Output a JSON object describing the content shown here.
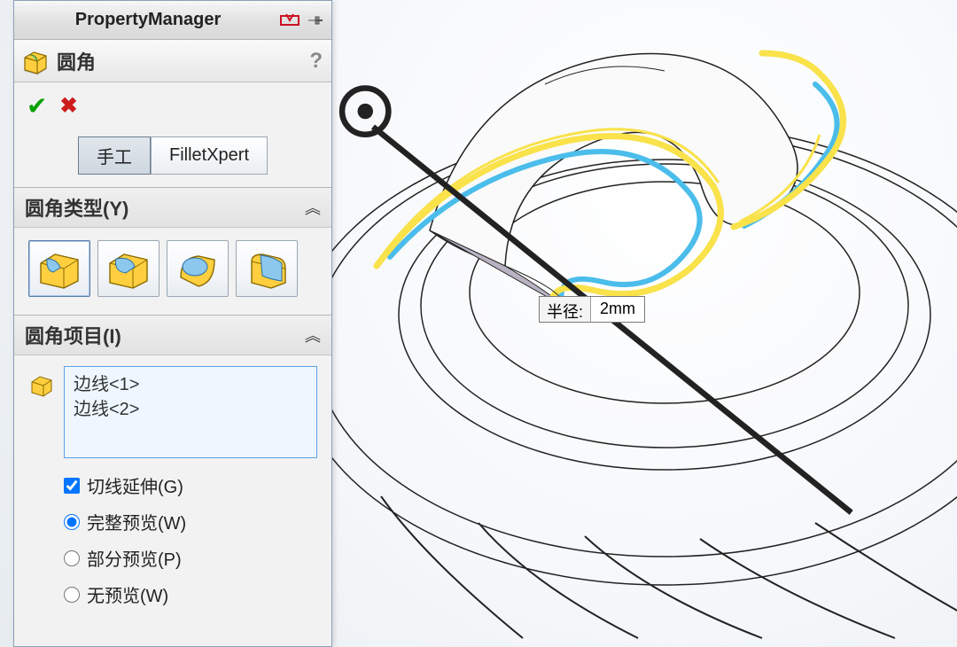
{
  "header": {
    "title": "PropertyManager"
  },
  "feature": {
    "name": "圆角"
  },
  "modes": {
    "manual": "手工",
    "filletxpert": "FilletXpert"
  },
  "groups": {
    "type": {
      "label": "圆角类型(Y)"
    },
    "items": {
      "label": "圆角项目(I)"
    }
  },
  "selection": {
    "items": [
      "边线<1>",
      "边线<2>"
    ]
  },
  "options": {
    "tangent": "切线延伸(G)",
    "full": "完整预览(W)",
    "partial": "部分预览(P)",
    "none": "无预览(W)"
  },
  "callout": {
    "label": "半径:",
    "value": "2mm"
  },
  "colors": {
    "highlight": "#4bbdeb",
    "select": "#f9e24a",
    "panel_border": "#8aa0b8"
  }
}
